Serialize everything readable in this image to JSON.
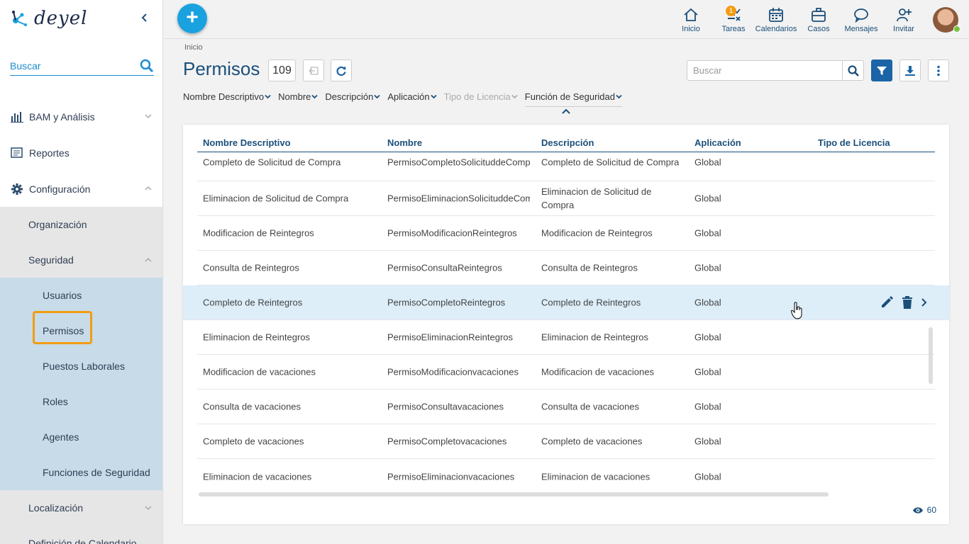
{
  "app": {
    "logo_text": "deyel"
  },
  "sidebar": {
    "search_placeholder": "Buscar",
    "items": [
      {
        "label": "BAM y Análisis"
      },
      {
        "label": "Reportes"
      },
      {
        "label": "Configuración"
      }
    ],
    "config_children": [
      {
        "label": "Organización"
      },
      {
        "label": "Seguridad"
      }
    ],
    "security_children": [
      {
        "label": "Usuarios"
      },
      {
        "label": "Permisos"
      },
      {
        "label": "Puestos Laborales"
      },
      {
        "label": "Roles"
      },
      {
        "label": "Agentes"
      },
      {
        "label": "Funciones de Seguridad"
      }
    ],
    "more_children": [
      {
        "label": "Localización"
      },
      {
        "label": "Definición de Calendario"
      }
    ],
    "active_item": "Permisos"
  },
  "topbar": {
    "icons": [
      {
        "label": "Inicio",
        "icon": "home-icon"
      },
      {
        "label": "Tareas",
        "icon": "tasks-icon",
        "badge": "1"
      },
      {
        "label": "Calendarios",
        "icon": "calendar-icon"
      },
      {
        "label": "Casos",
        "icon": "briefcase-icon"
      },
      {
        "label": "Mensajes",
        "icon": "message-icon"
      },
      {
        "label": "Invitar",
        "icon": "invite-icon"
      }
    ]
  },
  "main": {
    "breadcrumb": "Inicio",
    "title": "Permisos",
    "count": "109",
    "search_placeholder": "Buscar",
    "column_filters": [
      {
        "label": "Nombre Descriptivo",
        "enabled": true
      },
      {
        "label": "Nombre",
        "enabled": true
      },
      {
        "label": "Descripción",
        "enabled": true
      },
      {
        "label": "Aplicación",
        "enabled": true
      },
      {
        "label": "Tipo de Licencia",
        "enabled": false
      },
      {
        "label": "Función de Seguridad",
        "enabled": true
      }
    ],
    "table": {
      "headers": [
        "Nombre Descriptivo",
        "Nombre",
        "Descripción",
        "Aplicación",
        "Tipo de Licencia"
      ],
      "rows": [
        [
          "Completo de Solicitud de Compra",
          "PermisoCompletoSolicituddeCompra",
          "Completo de Solicitud de Compra",
          "Global",
          ""
        ],
        [
          "Eliminacion de Solicitud de Compra",
          "PermisoEliminacionSolicituddeCompra",
          "Eliminacion de Solicitud de Compra",
          "Global",
          ""
        ],
        [
          "Modificacion de Reintegros",
          "PermisoModificacionReintegros",
          "Modificacion de Reintegros",
          "Global",
          ""
        ],
        [
          "Consulta de Reintegros",
          "PermisoConsultaReintegros",
          "Consulta de Reintegros",
          "Global",
          ""
        ],
        [
          "Completo de Reintegros",
          "PermisoCompletoReintegros",
          "Completo de Reintegros",
          "Global",
          ""
        ],
        [
          "Eliminacion de Reintegros",
          "PermisoEliminacionReintegros",
          "Eliminacion de Reintegros",
          "Global",
          ""
        ],
        [
          "Modificacion de vacaciones",
          "PermisoModificacionvacaciones",
          "Modificacion de vacaciones",
          "Global",
          ""
        ],
        [
          "Consulta de vacaciones",
          "PermisoConsultavacaciones",
          "Consulta de vacaciones",
          "Global",
          ""
        ],
        [
          "Completo de vacaciones",
          "PermisoCompletovacaciones",
          "Completo de vacaciones",
          "Global",
          ""
        ],
        [
          "Eliminacion de vacaciones",
          "PermisoEliminacionvacaciones",
          "Eliminacion de vacaciones",
          "Global",
          ""
        ]
      ],
      "highlighted_row": 4
    },
    "visible_count": "60"
  },
  "colors": {
    "primary": "#1b4f7a",
    "accent": "#1aa1e0",
    "highlight": "#f39c12",
    "row_hover": "#ddeef9"
  }
}
